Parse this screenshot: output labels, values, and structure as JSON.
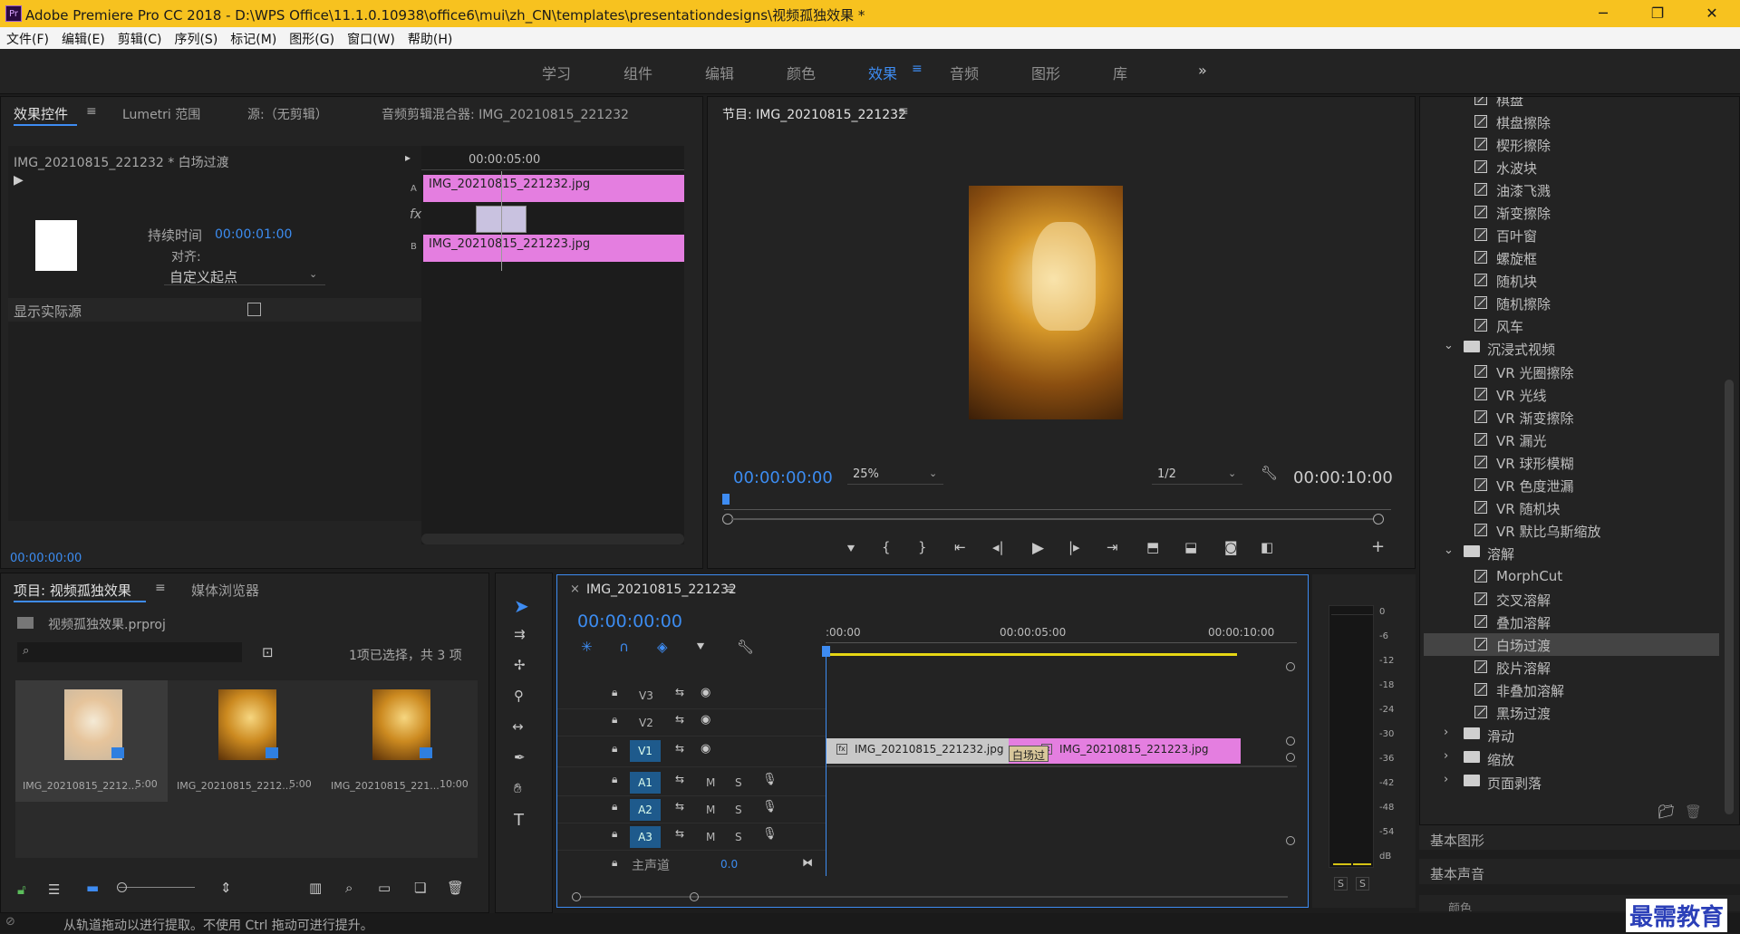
{
  "app": {
    "title": "Adobe Premiere Pro CC 2018 - D:\\WPS Office\\11.1.0.10938\\office6\\mui\\zh_CN\\templates\\presentationdesigns\\视频孤独效果 *",
    "logo": "Pr",
    "minimize": "─",
    "restore": "❐",
    "close": "✕"
  },
  "menu": [
    "文件(F)",
    "编辑(E)",
    "剪辑(C)",
    "序列(S)",
    "标记(M)",
    "图形(G)",
    "窗口(W)",
    "帮助(H)"
  ],
  "workspaces": [
    "学习",
    "组件",
    "编辑",
    "颜色",
    "效果",
    "音频",
    "图形",
    "库"
  ],
  "workspaces_active": "效果",
  "workspaces_more": "»",
  "effect_controls": {
    "tabs": [
      "效果控件",
      "Lumetri 范围",
      "源:（无剪辑）",
      "音频剪辑混合器: IMG_20210815_221232"
    ],
    "clip_path": "IMG_20210815_221232 * 白场过渡",
    "timecode_ruler": "00:00:05:00",
    "clip_a": "IMG_20210815_221232.jpg",
    "clip_b": "IMG_20210815_221223.jpg",
    "track_a": "A",
    "track_b": "B",
    "duration_label": "持续时间",
    "duration_value": "00:00:01:00",
    "align_label": "对齐:",
    "align_value": "自定义起点",
    "show_actual_label": "显示实际源",
    "current_time": "00:00:00:00"
  },
  "program": {
    "title": "节目: IMG_20210815_221232",
    "timecode": "00:00:00:00",
    "zoom": "25%",
    "resolution": "1/2",
    "duration": "00:00:10:00"
  },
  "effects_list": {
    "items": [
      {
        "type": "item",
        "label": "棋盘"
      },
      {
        "type": "item",
        "label": "棋盘擦除"
      },
      {
        "type": "item",
        "label": "楔形擦除"
      },
      {
        "type": "item",
        "label": "水波块"
      },
      {
        "type": "item",
        "label": "油漆飞溅"
      },
      {
        "type": "item",
        "label": "渐变擦除"
      },
      {
        "type": "item",
        "label": "百叶窗"
      },
      {
        "type": "item",
        "label": "螺旋框"
      },
      {
        "type": "item",
        "label": "随机块"
      },
      {
        "type": "item",
        "label": "随机擦除"
      },
      {
        "type": "item",
        "label": "风车"
      },
      {
        "type": "folder",
        "label": "沉浸式视频",
        "open": true
      },
      {
        "type": "item",
        "label": "VR 光圈擦除"
      },
      {
        "type": "item",
        "label": "VR 光线"
      },
      {
        "type": "item",
        "label": "VR 渐变擦除"
      },
      {
        "type": "item",
        "label": "VR 漏光"
      },
      {
        "type": "item",
        "label": "VR 球形模糊"
      },
      {
        "type": "item",
        "label": "VR 色度泄漏"
      },
      {
        "type": "item",
        "label": "VR 随机块"
      },
      {
        "type": "item",
        "label": "VR 默比乌斯缩放"
      },
      {
        "type": "folder",
        "label": "溶解",
        "open": true
      },
      {
        "type": "item",
        "label": "MorphCut"
      },
      {
        "type": "item",
        "label": "交叉溶解"
      },
      {
        "type": "item",
        "label": "叠加溶解"
      },
      {
        "type": "item",
        "label": "白场过渡",
        "selected": true
      },
      {
        "type": "item",
        "label": "胶片溶解"
      },
      {
        "type": "item",
        "label": "非叠加溶解"
      },
      {
        "type": "item",
        "label": "黑场过渡"
      },
      {
        "type": "folder",
        "label": "滑动",
        "open": false
      },
      {
        "type": "folder",
        "label": "缩放",
        "open": false
      },
      {
        "type": "folder",
        "label": "页面剥落",
        "open": false
      }
    ],
    "sections": [
      "基本图形",
      "基本声音"
    ],
    "cut_off": "颜色"
  },
  "project": {
    "tabs": [
      "项目: 视频孤独效果",
      "媒体浏览器"
    ],
    "file": "视频孤独效果.prproj",
    "selection": "1项已选择，共 3 项",
    "items": [
      {
        "name": "IMG_20210815_2212...",
        "duration": "5:00"
      },
      {
        "name": "IMG_20210815_2212...",
        "duration": "5:00"
      },
      {
        "name": "IMG_20210815_221...",
        "duration": "10:00"
      }
    ]
  },
  "timeline": {
    "title": "IMG_20210815_221232",
    "timecode": "00:00:00:00",
    "ruler": [
      ":00:00",
      "00:00:05:00",
      "00:00:10:00"
    ],
    "video_tracks": [
      "V3",
      "V2",
      "V1"
    ],
    "audio_tracks": [
      "A1",
      "A2",
      "A3"
    ],
    "master": "主声道",
    "master_value": "0.0",
    "clip1": "IMG_20210815_221232.jpg",
    "clip2": "IMG_20210815_221223.jpg",
    "transition": "白场过",
    "mute": "M",
    "solo": "S",
    "fx": "fx"
  },
  "meter": {
    "labels": [
      "0",
      "-6",
      "-12",
      "-18",
      "-24",
      "-30",
      "-36",
      "-42",
      "-48",
      "-54",
      "dB"
    ],
    "solo": [
      "S",
      "S"
    ]
  },
  "statusbar": "从轨道拖动以进行提取。不使用 Ctrl 拖动可进行提升。",
  "watermark": "最需教育",
  "colors": {
    "accent": "#3e8cf2",
    "clip": "#e47ee0",
    "titlebar": "#f7c21f"
  }
}
